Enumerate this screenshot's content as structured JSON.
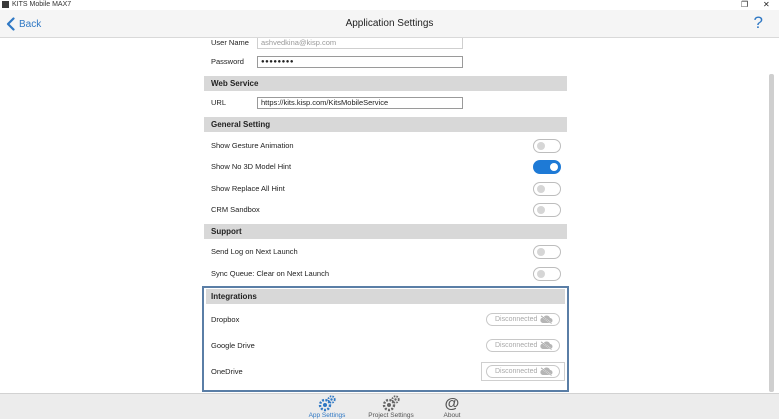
{
  "window": {
    "title": "KITS Mobile MAX7",
    "restore_glyph": "❐",
    "close_glyph": "✕"
  },
  "header": {
    "back_label": "Back",
    "title": "Application Settings",
    "help_glyph": "?"
  },
  "account": {
    "user_name_label": "User Name",
    "user_name_value": "ashvedkina@kisp.com",
    "password_label": "Password",
    "password_value": "●●●●●●●●"
  },
  "web_service": {
    "title": "Web Service",
    "url_label": "URL",
    "url_value": "https://kits.kisp.com/KitsMobileService"
  },
  "general": {
    "title": "General Setting",
    "items": [
      {
        "label": "Show Gesture Animation",
        "on": false
      },
      {
        "label": "Show No 3D Model Hint",
        "on": true
      },
      {
        "label": "Show Replace All Hint",
        "on": false
      },
      {
        "label": "CRM Sandbox",
        "on": false
      }
    ]
  },
  "support": {
    "title": "Support",
    "items": [
      {
        "label": "Send Log on Next Launch",
        "on": false
      },
      {
        "label": "Sync Queue: Clear on Next Launch",
        "on": false
      }
    ]
  },
  "integrations": {
    "title": "Integrations",
    "items": [
      {
        "label": "Dropbox",
        "status": "Disconnected"
      },
      {
        "label": "Google Drive",
        "status": "Disconnected"
      },
      {
        "label": "OneDrive",
        "status": "Disconnected"
      }
    ]
  },
  "tabs": [
    {
      "label": "App Settings",
      "icon": "gears-icon",
      "active": true
    },
    {
      "label": "Project Settings",
      "icon": "gears-icon",
      "active": false
    },
    {
      "label": "About",
      "icon": "at-sign-icon",
      "active": false
    }
  ],
  "colors": {
    "accent": "#2f78c4",
    "toggle_on": "#1e7ad6",
    "section_bg": "#d8d8d8",
    "highlight_border": "#5a7ea6"
  }
}
